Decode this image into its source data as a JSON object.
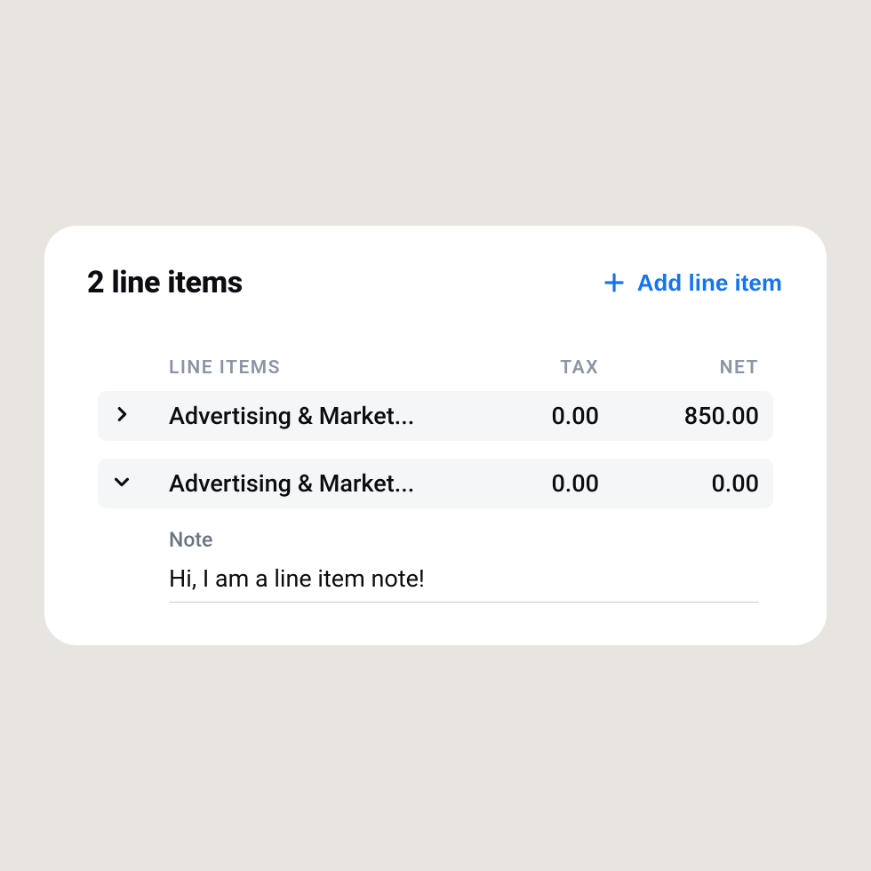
{
  "header": {
    "title": "2 line items",
    "add_label": "Add line item"
  },
  "table": {
    "columns": {
      "items": "LINE ITEMS",
      "tax": "TAX",
      "net": "NET"
    },
    "rows": [
      {
        "expanded": false,
        "name": "Advertising & Market...",
        "tax": "0.00",
        "net": "850.00"
      },
      {
        "expanded": true,
        "name": "Advertising & Market...",
        "tax": "0.00",
        "net": "0.00",
        "note_label": "Note",
        "note_value": "Hi, I am a line item note!"
      }
    ]
  }
}
